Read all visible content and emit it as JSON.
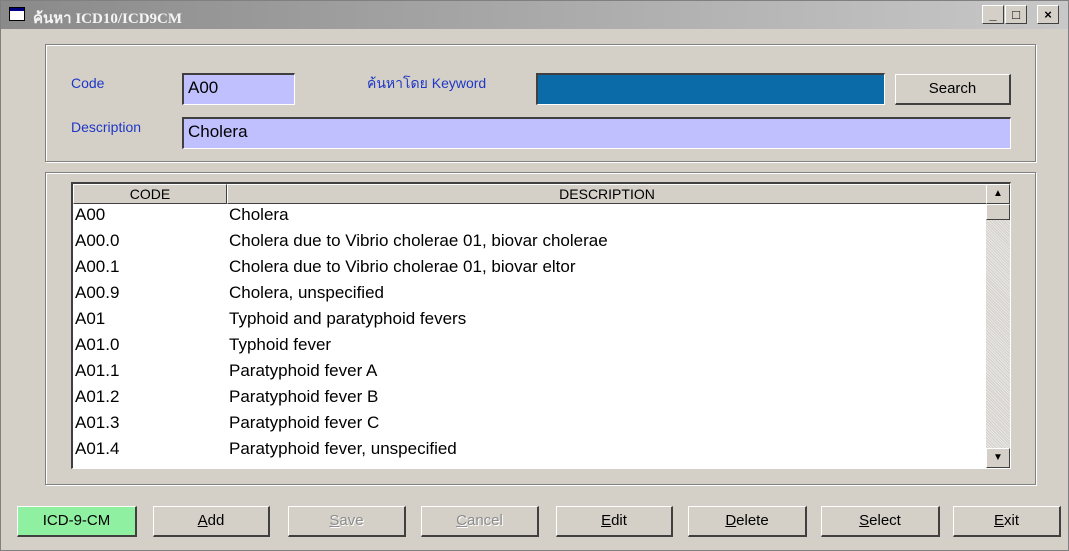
{
  "window": {
    "title": "ค้นหา ICD10/ICD9CM",
    "minimize_label": "_",
    "maximize_label": "□",
    "close_label": "×"
  },
  "search": {
    "code_label": "Code",
    "code_value": "A00",
    "keyword_label": "ค้นหาโดย Keyword",
    "keyword_value": "",
    "search_button": "Search",
    "description_label": "Description",
    "description_value": "Cholera"
  },
  "table": {
    "columns": [
      "CODE",
      "DESCRIPTION"
    ],
    "rows": [
      {
        "code": "A00",
        "description": "Cholera"
      },
      {
        "code": "A00.0",
        "description": "Cholera due to Vibrio cholerae 01, biovar cholerae"
      },
      {
        "code": "A00.1",
        "description": "Cholera due to Vibrio cholerae 01, biovar eltor"
      },
      {
        "code": "A00.9",
        "description": "Cholera, unspecified"
      },
      {
        "code": "A01",
        "description": "Typhoid and paratyphoid fevers"
      },
      {
        "code": "A01.0",
        "description": "Typhoid fever"
      },
      {
        "code": "A01.1",
        "description": "Paratyphoid fever A"
      },
      {
        "code": "A01.2",
        "description": "Paratyphoid fever B"
      },
      {
        "code": "A01.3",
        "description": "Paratyphoid fever C"
      },
      {
        "code": "A01.4",
        "description": "Paratyphoid fever, unspecified"
      }
    ]
  },
  "toolbar": {
    "mode_button": "ICD-9-CM",
    "add": {
      "accel": "A",
      "rest": "dd"
    },
    "save": {
      "accel": "S",
      "rest": "ave"
    },
    "cancel": {
      "accel": "C",
      "rest": "ancel"
    },
    "edit": {
      "accel": "E",
      "rest": "dit"
    },
    "delete": {
      "accel": "D",
      "rest": "elete"
    },
    "select": {
      "accel": "S",
      "rest": "elect"
    },
    "exit": {
      "accel": "E",
      "rest": "xit"
    }
  },
  "colors": {
    "code_field_bg": "#c0c0ff",
    "keyword_field_bg": "#0a6ba8",
    "mode_button_bg": "#8ef0a0",
    "label_blue": "#1f37c6"
  }
}
